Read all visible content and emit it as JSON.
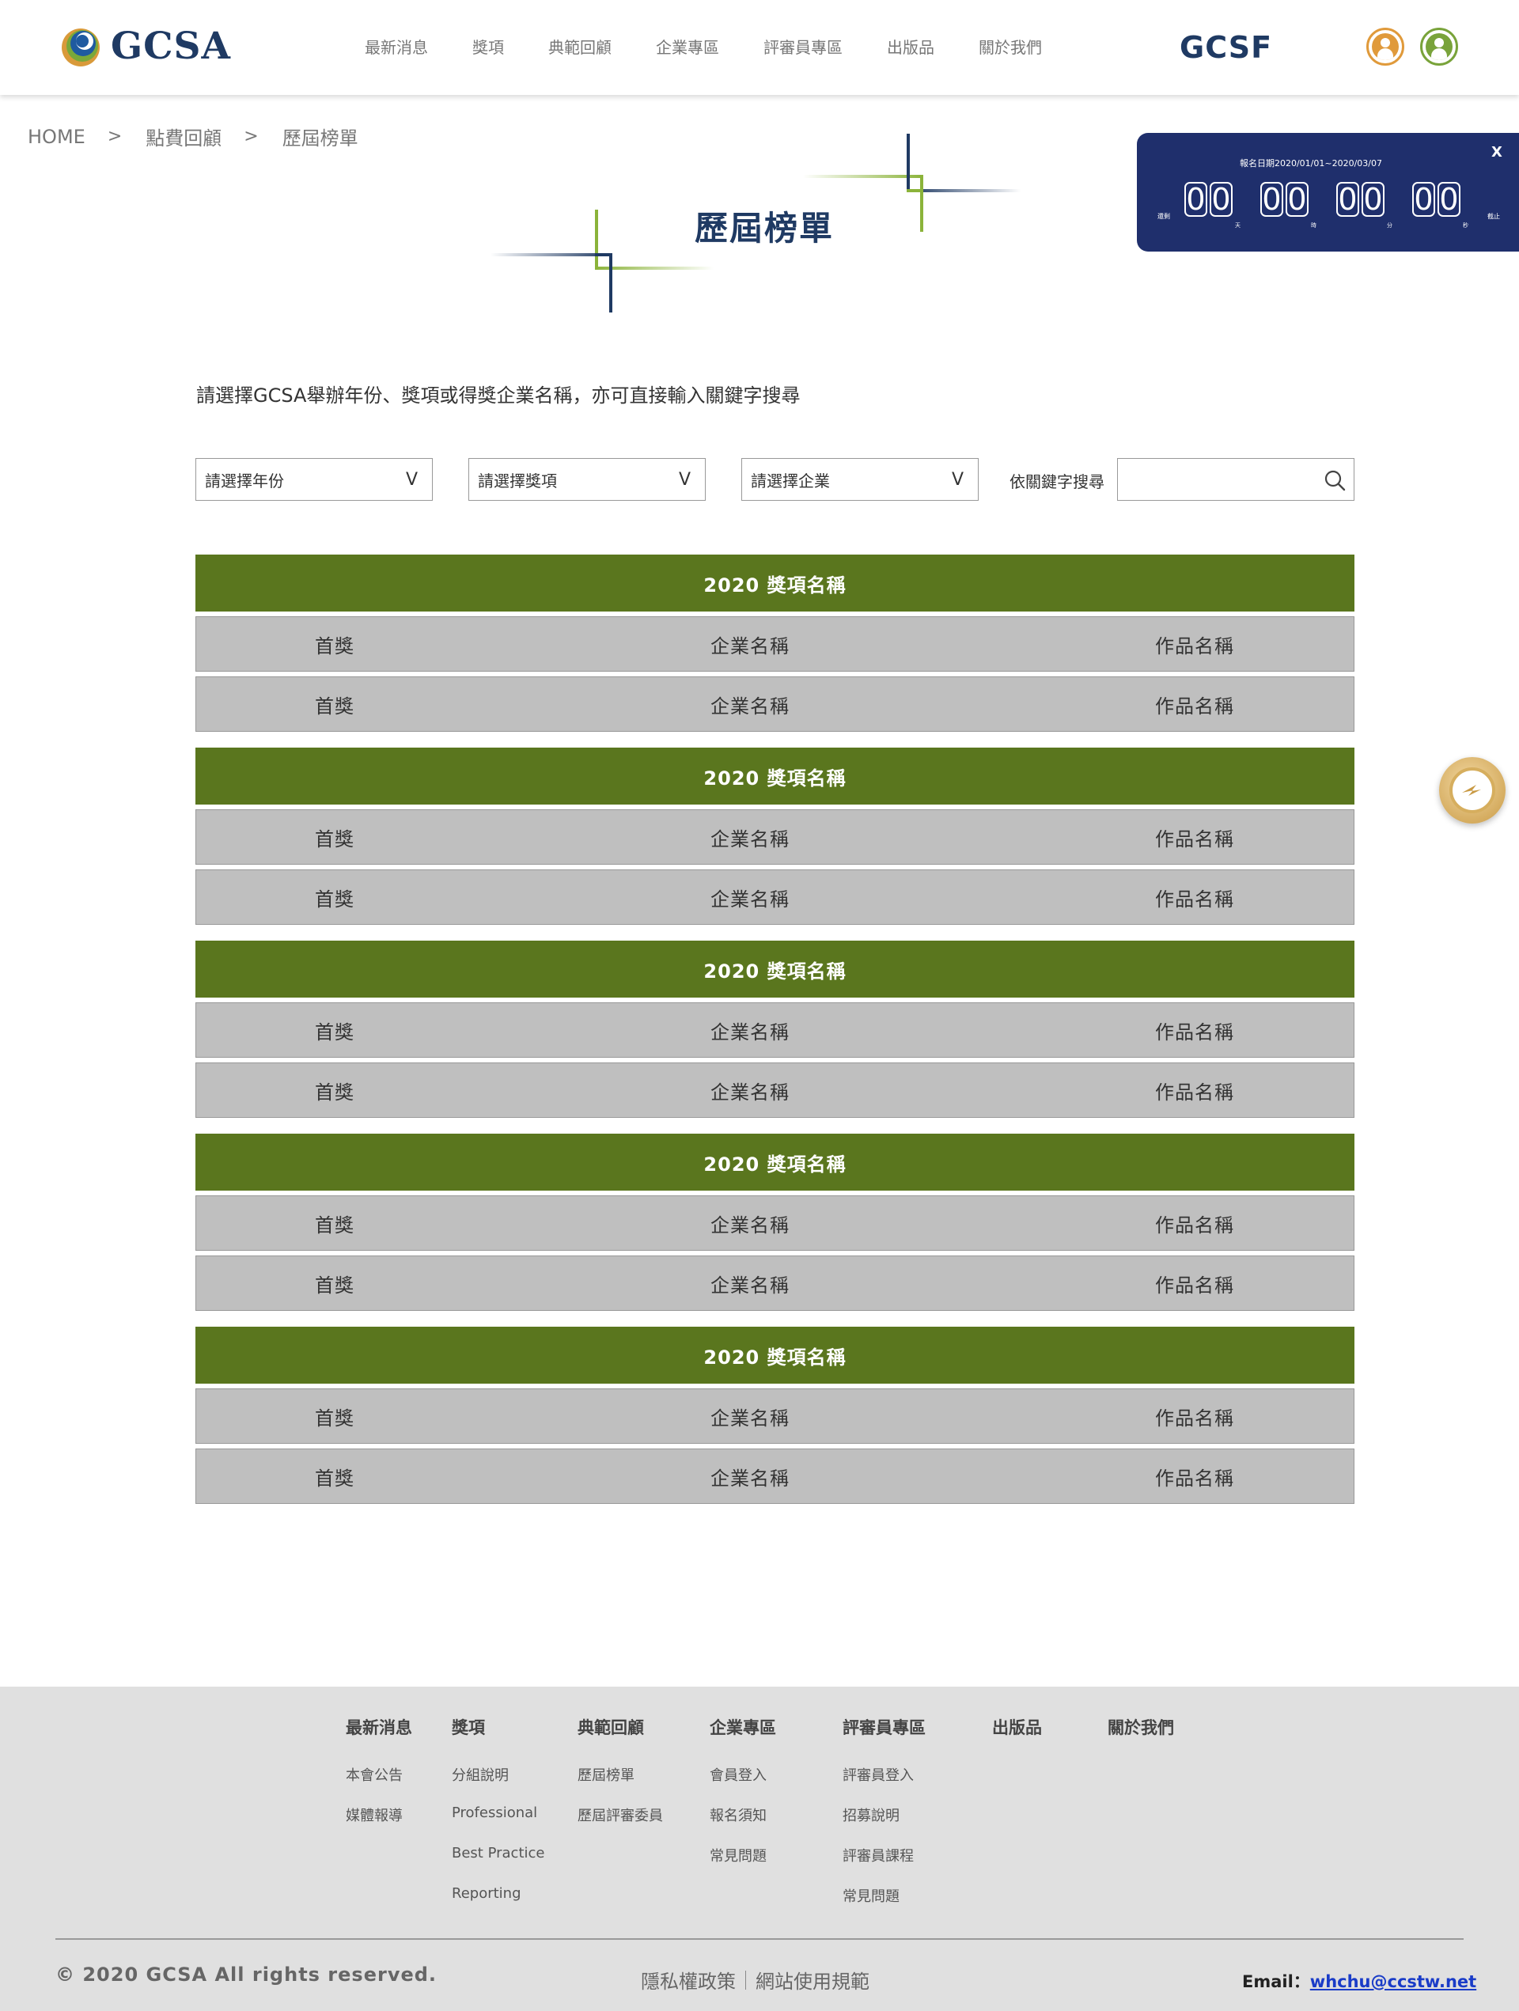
{
  "header": {
    "logo_text": "GCSA",
    "nav": [
      "最新消息",
      "獎項",
      "典範回顧",
      "企業專區",
      "評審員專區",
      "出版品",
      "關於我們"
    ],
    "brand_right": "GCSF",
    "colors": {
      "brand_navy": "#1f3a63",
      "user_orange": "#e09a3b",
      "user_green": "#79a33a"
    }
  },
  "breadcrumb": {
    "home": "HOME",
    "sep": ">",
    "level1": "點費回顧",
    "level2": "歷屆榜單"
  },
  "page": {
    "title": "歷屆榜單"
  },
  "countdown": {
    "title": "報名日期2020/01/01~2020/03/07",
    "close": "X",
    "label_left": "還剩",
    "label_right": "截止",
    "digits": [
      "0",
      "0",
      "0",
      "0",
      "0",
      "0",
      "0",
      "0"
    ],
    "units": [
      "天",
      "時",
      "分",
      "秒"
    ]
  },
  "intro": "請選擇GCSA舉辦年份、獎項或得獎企業名稱，亦可直接輸入關鍵字搜尋",
  "filters": {
    "year": "請選擇年份",
    "award": "請選擇獎項",
    "company": "請選擇企業",
    "caret": "V",
    "keyword_label": "依關鍵字搜尋",
    "keyword_value": ""
  },
  "groups": [
    {
      "title": "2020 獎項名稱",
      "rows": [
        [
          "首獎",
          "企業名稱",
          "作品名稱"
        ],
        [
          "首獎",
          "企業名稱",
          "作品名稱"
        ]
      ]
    },
    {
      "title": "2020 獎項名稱",
      "rows": [
        [
          "首獎",
          "企業名稱",
          "作品名稱"
        ],
        [
          "首獎",
          "企業名稱",
          "作品名稱"
        ]
      ]
    },
    {
      "title": "2020 獎項名稱",
      "rows": [
        [
          "首獎",
          "企業名稱",
          "作品名稱"
        ],
        [
          "首獎",
          "企業名稱",
          "作品名稱"
        ]
      ]
    },
    {
      "title": "2020 獎項名稱",
      "rows": [
        [
          "首獎",
          "企業名稱",
          "作品名稱"
        ],
        [
          "首獎",
          "企業名稱",
          "作品名稱"
        ]
      ]
    },
    {
      "title": "2020 獎項名稱",
      "rows": [
        [
          "首獎",
          "企業名稱",
          "作品名稱"
        ],
        [
          "首獎",
          "企業名稱",
          "作品名稱"
        ]
      ]
    }
  ],
  "footer": {
    "columns": [
      {
        "head": "最新消息",
        "links": [
          "本會公告",
          "媒體報導"
        ]
      },
      {
        "head": "獎項",
        "links": [
          "分組說明",
          "Professional",
          "Best Practice",
          "Reporting"
        ]
      },
      {
        "head": "典範回顧",
        "links": [
          "歷屆榜單",
          "歷屆評審委員"
        ]
      },
      {
        "head": "企業專區",
        "links": [
          "會員登入",
          "報名須知",
          "常見問題"
        ]
      },
      {
        "head": "評審員專區",
        "links": [
          "評審員登入",
          "招募說明",
          "評審員課程",
          "常見問題"
        ]
      },
      {
        "head": "出版品",
        "links": []
      },
      {
        "head": "關於我們",
        "links": []
      }
    ],
    "copyright": "© 2020 GCSA All rights reserved.",
    "privacy": "隱私權政策",
    "terms": "網站使用規範",
    "email_label": "Email：",
    "email": "whchu@ccstw.net"
  }
}
